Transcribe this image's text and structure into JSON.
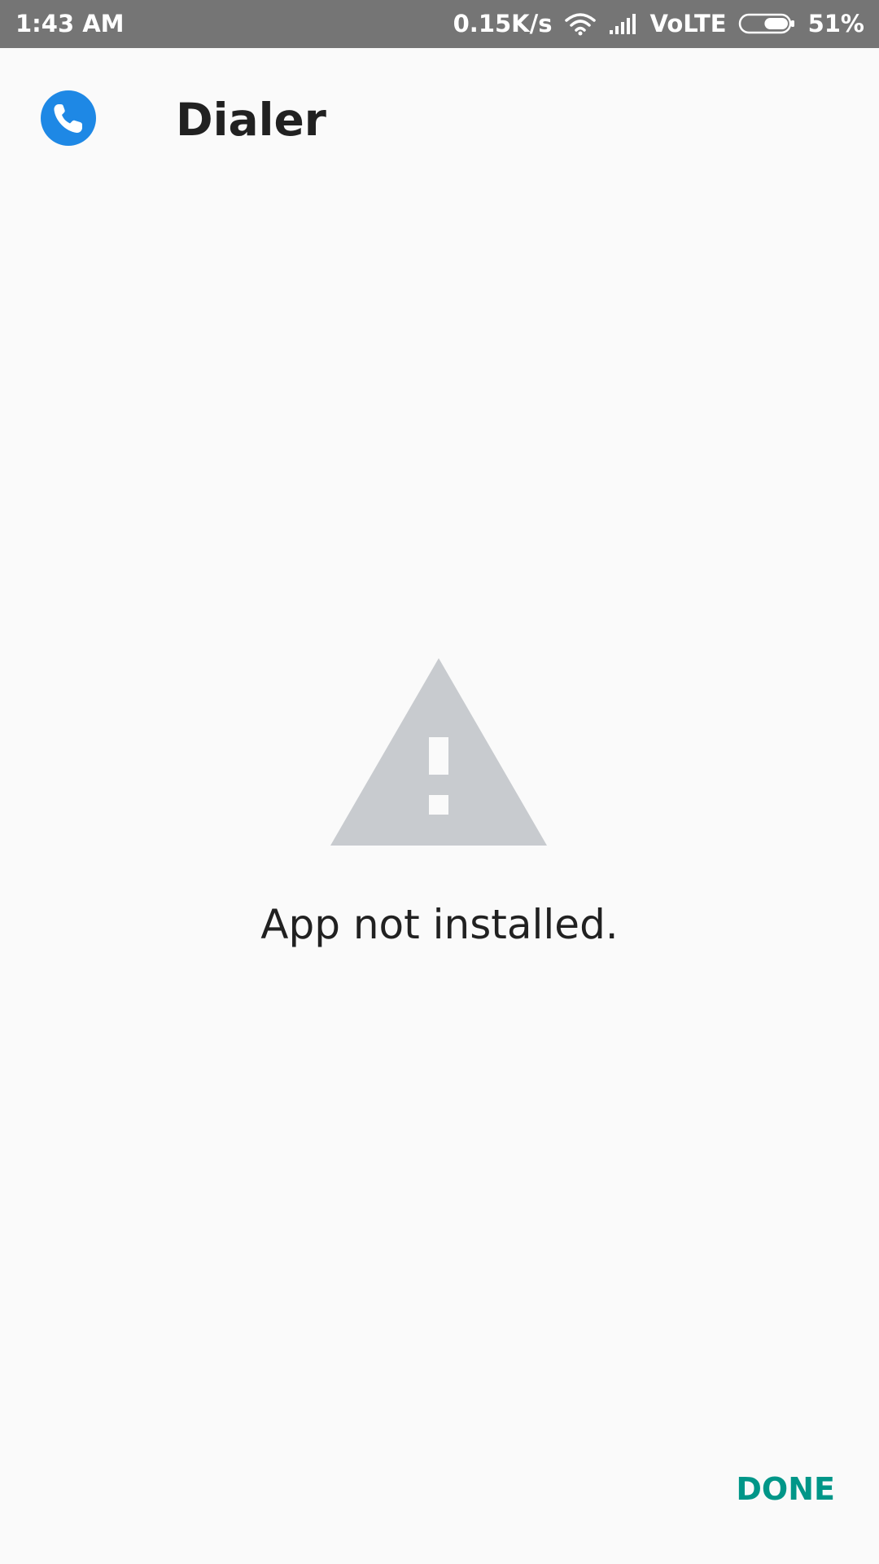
{
  "status_bar": {
    "time": "1:43 AM",
    "net_speed": "0.15K/s",
    "network_type": "VoLTE",
    "battery_percent": "51%",
    "battery_level": 0.51,
    "icons": [
      "wifi-icon",
      "signal-icon",
      "battery-icon"
    ]
  },
  "header": {
    "app_name": "Dialer",
    "app_icon": "phone-icon",
    "app_icon_color": "#1e88e5"
  },
  "main": {
    "status_icon": "warning-icon",
    "status_icon_color": "#c8cbcf",
    "message": "App not installed."
  },
  "footer": {
    "done_label": "DONE",
    "accent_color": "#009688"
  }
}
